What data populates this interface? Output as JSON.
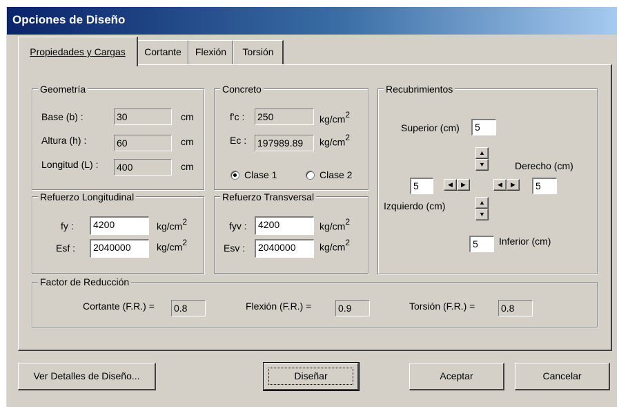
{
  "window": {
    "title": "Opciones de Diseño"
  },
  "tabs": [
    {
      "label": "Propiedades y Cargas",
      "active": true
    },
    {
      "label": "Cortante",
      "active": false
    },
    {
      "label": "Flexión",
      "active": false
    },
    {
      "label": "Torsión",
      "active": false
    }
  ],
  "geometria": {
    "title": "Geometría",
    "base": {
      "label": "Base (b) :",
      "value": "30",
      "unit": "cm"
    },
    "altura": {
      "label": "Altura (h) :",
      "value": "60",
      "unit": "cm"
    },
    "longitud": {
      "label": "Longitud (L) :",
      "value": "400",
      "unit": "cm"
    }
  },
  "concreto": {
    "title": "Concreto",
    "fc": {
      "label": "f'c :",
      "value": "250",
      "unit": "kg/cm",
      "exp": "2"
    },
    "ec": {
      "label": "Ec :",
      "value": "197989.89",
      "unit": "kg/cm",
      "exp": "2"
    },
    "clase1": {
      "label": "Clase 1",
      "selected": true
    },
    "clase2": {
      "label": "Clase 2",
      "selected": false
    }
  },
  "recubrimientos": {
    "title": "Recubrimientos",
    "superior": {
      "label": "Superior (cm)",
      "value": "5"
    },
    "derecho": {
      "label": "Derecho (cm)",
      "value": "5"
    },
    "izquierdo": {
      "label": "Izquierdo (cm)",
      "value": "5"
    },
    "inferior": {
      "label": "Inferior (cm)",
      "value": "5"
    },
    "arrows": {
      "up": "▲",
      "down": "▼",
      "left": "◀",
      "right": "▶"
    }
  },
  "ref_long": {
    "title": "Refuerzo Longitudinal",
    "fy": {
      "label": "fy :",
      "value": "4200",
      "unit": "kg/cm",
      "exp": "2"
    },
    "esf": {
      "label": "Esf :",
      "value": "2040000",
      "unit": "kg/cm",
      "exp": "2"
    }
  },
  "ref_trans": {
    "title": "Refuerzo Transversal",
    "fyv": {
      "label": "fyv :",
      "value": "4200",
      "unit": "kg/cm",
      "exp": "2"
    },
    "esv": {
      "label": "Esv :",
      "value": "2040000",
      "unit": "kg/cm",
      "exp": "2"
    }
  },
  "factor": {
    "title": "Factor de Reducción",
    "cortante": {
      "label": "Cortante (F.R.) =",
      "value": "0.8"
    },
    "flexion": {
      "label": "Flexión (F.R.) =",
      "value": "0.9"
    },
    "torsion": {
      "label": "Torsión (F.R.) =",
      "value": "0.8"
    }
  },
  "buttons": {
    "ver_detalles": "Ver Detalles de Diseño...",
    "disenar": "Diseñar",
    "aceptar": "Aceptar",
    "cancelar": "Cancelar"
  }
}
